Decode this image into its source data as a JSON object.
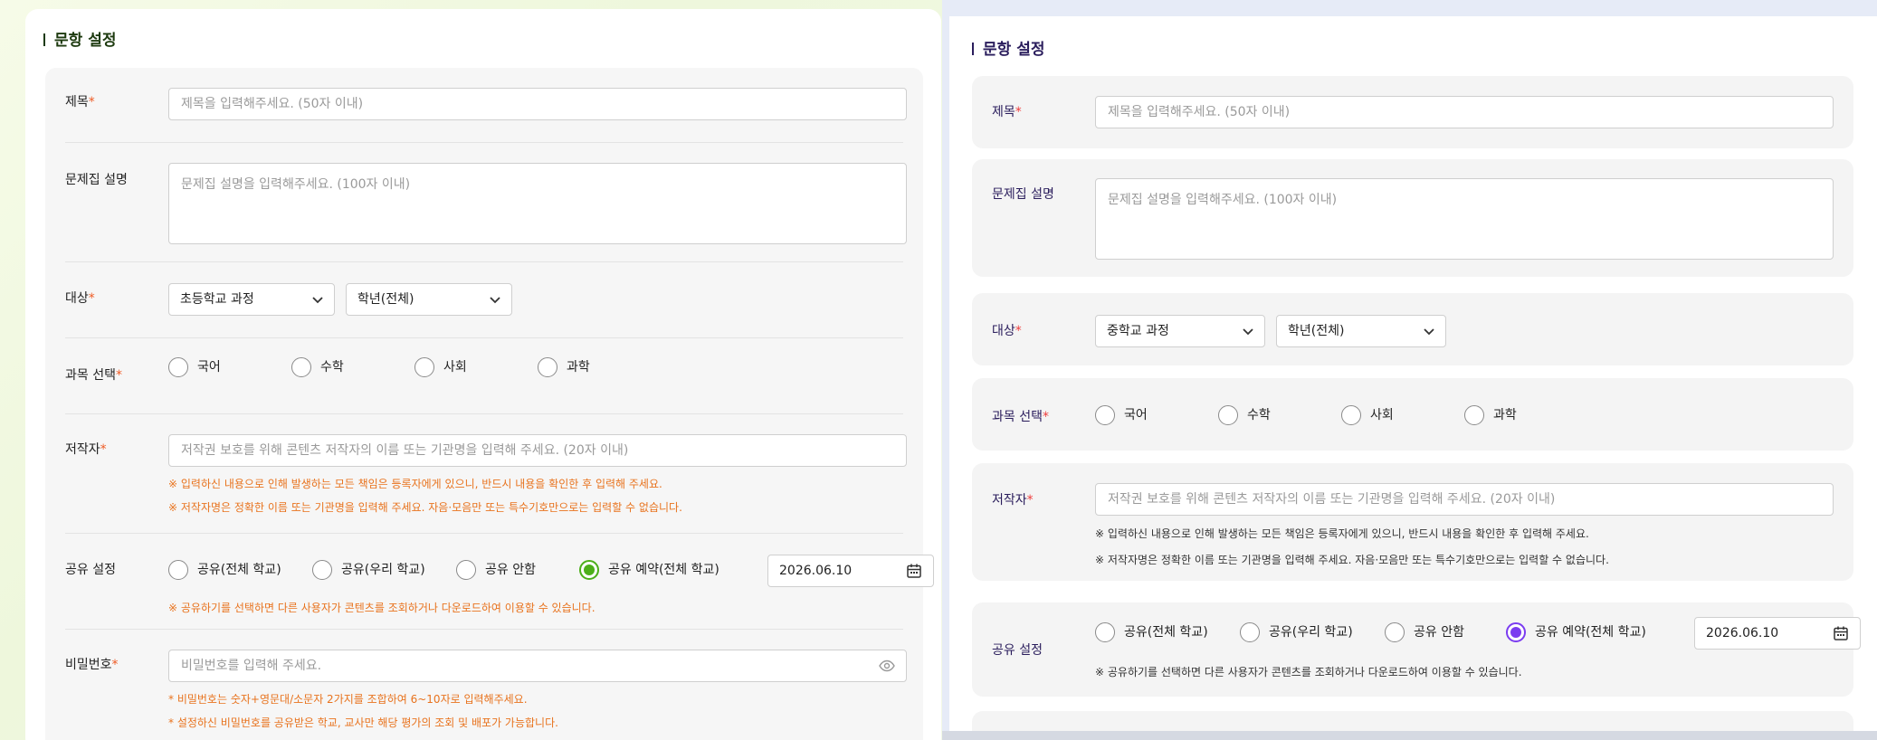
{
  "left": {
    "section_title": "문항 설정",
    "title_label": "제목",
    "title_placeholder": "제목을 입력해주세요. (50자 이내)",
    "desc_label": "문제집 설명",
    "desc_placeholder": "문제집 설명을 입력해주세요. (100자 이내)",
    "target_label": "대상",
    "course_value": "초등학교 과정",
    "grade_value": "학년(전체)",
    "subject_label": "과목 선택",
    "subjects": [
      "국어",
      "수학",
      "사회",
      "과학"
    ],
    "author_label": "저작자",
    "author_placeholder": "저작권 보호를 위해 콘텐츠 저작자의 이름 또는 기관명을 입력해 주세요. (20자 이내)",
    "author_note_1": "※ 입력하신 내용으로 인해 발생하는 모든 책임은 등록자에게 있으니, 반드시 내용을 확인한 후 입력해 주세요.",
    "author_note_2": "※ 저작자명은 정확한 이름 또는 기관명을 입력해 주세요. 자음·모음만 또는 특수기호만으로는 입력할 수 없습니다.",
    "share_label": "공유 설정",
    "share_options": [
      "공유(전체 학교)",
      "공유(우리 학교)",
      "공유 안함",
      "공유 예약(전체 학교)"
    ],
    "share_date": "2026.06.10",
    "share_note": "※ 공유하기를 선택하면 다른 사용자가 콘텐츠를 조회하거나 다운로드하여 이용할 수 있습니다.",
    "password_label": "비밀번호",
    "password_placeholder": "비밀번호를 입력해 주세요.",
    "password_note_1": "* 비밀번호는 숫자+영문대/소문자 2가지를 조합하여 6~10자로 입력해주세요.",
    "password_note_2": "* 설정하신 비밀번호를 공유받은 학교, 교사만 해당 평가의 조회 및 배포가 가능합니다."
  },
  "right": {
    "section_title": "문항 설정",
    "title_label": "제목",
    "title_placeholder": "제목을 입력해주세요. (50자 이내)",
    "desc_label": "문제집 설명",
    "desc_placeholder": "문제집 설명을 입력해주세요. (100자 이내)",
    "target_label": "대상",
    "course_value": "중학교 과정",
    "grade_value": "학년(전체)",
    "subject_label": "과목 선택",
    "subjects": [
      "국어",
      "수학",
      "사회",
      "과학"
    ],
    "author_label": "저작자",
    "author_placeholder": "저작권 보호를 위해 콘텐츠 저작자의 이름 또는 기관명을 입력해 주세요. (20자 이내)",
    "author_note_1": "※ 입력하신 내용으로 인해 발생하는 모든 책임은 등록자에게 있으니, 반드시 내용을 확인한 후 입력해 주세요.",
    "author_note_2": "※ 저작자명은 정확한 이름 또는 기관명을 입력해 주세요. 자음·모음만 또는 특수기호만으로는 입력할 수 없습니다.",
    "share_label": "공유 설정",
    "share_options": [
      "공유(전체 학교)",
      "공유(우리 학교)",
      "공유 안함",
      "공유 예약(전체 학교)"
    ],
    "share_date": "2026.06.10",
    "share_note": "※ 공유하기를 선택하면 다른 사용자가 콘텐츠를 조회하거나 다운로드하여 이용할 수 있습니다."
  },
  "required_mark": "*",
  "colors": {
    "left_accent": "#4caf1a",
    "right_accent": "#7b3cf0",
    "note_orange": "#e8731e",
    "required_left": "#ef5b25",
    "required_right": "#ef3d3d"
  },
  "icons": [
    "chevron-down-icon",
    "calendar-icon",
    "eye-icon"
  ]
}
